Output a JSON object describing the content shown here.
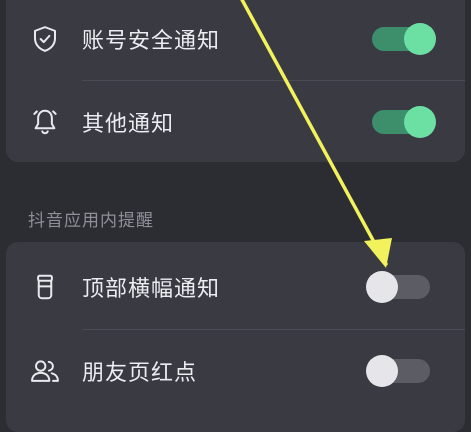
{
  "section1": {
    "items": [
      {
        "label": "账号安全通知",
        "icon": "shield-check-icon",
        "enabled": true
      },
      {
        "label": "其他通知",
        "icon": "bell-icon",
        "enabled": true
      }
    ]
  },
  "section2": {
    "title": "抖音应用内提醒",
    "items": [
      {
        "label": "顶部横幅通知",
        "icon": "cup-icon",
        "enabled": false
      },
      {
        "label": "朋友页红点",
        "icon": "friends-icon",
        "enabled": false
      }
    ]
  },
  "colors": {
    "background": "#2c2d33",
    "card": "#393a42",
    "toggle_on_track": "#3d8e6b",
    "toggle_on_knob": "#6ce0a3",
    "toggle_off_track": "#5b5c64",
    "toggle_off_knob": "#e6e6ea",
    "annotation_arrow": "#f2f25c"
  }
}
